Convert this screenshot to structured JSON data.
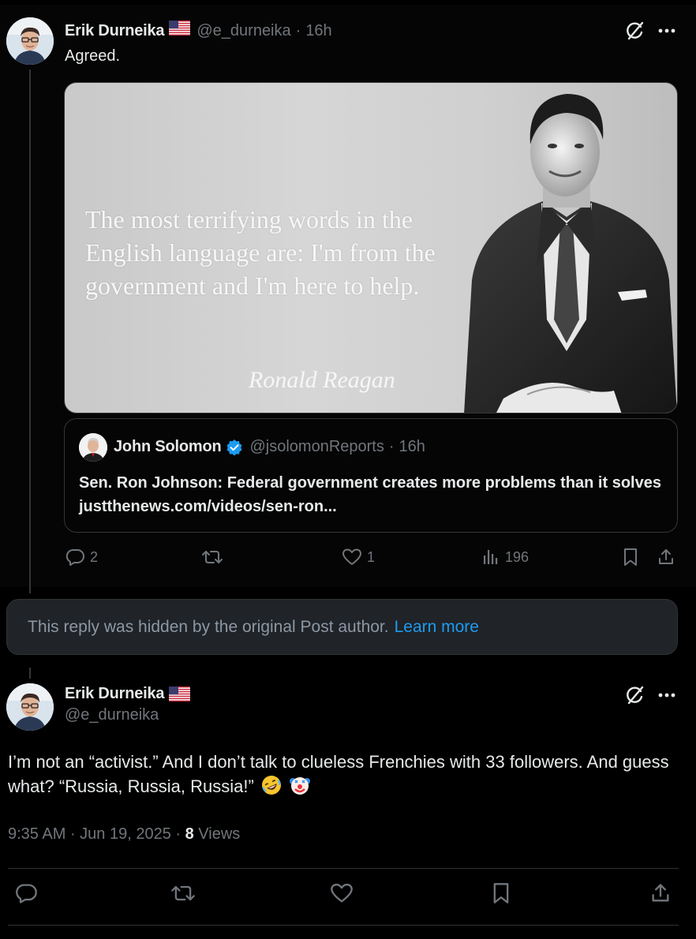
{
  "post1": {
    "author_name": "Erik Durneika",
    "handle": "@e_durneika",
    "time": "16h",
    "text": "Agreed.",
    "image": {
      "quote": "The most terrifying words in the English language are: I'm from the government and I'm here to help.",
      "author": "Ronald Reagan"
    },
    "quoted": {
      "author_name": "John Solomon",
      "handle": "@jsolomonReports",
      "time": "16h",
      "text": "Sen. Ron Johnson: Federal government creates more problems than it solves justthenews.com/videos/sen-ron..."
    },
    "actions": {
      "replies": "2",
      "reposts": "",
      "likes": "1",
      "views": "196"
    }
  },
  "hidden_notice": {
    "text": "This reply was hidden by the original Post author.",
    "link": "Learn more"
  },
  "post2": {
    "author_name": "Erik Durneika",
    "handle": "@e_durneika",
    "text": "I’m not an “activist.” And I don’t talk to clueless Frenchies with 33 followers. And guess what? “Russia, Russia, Russia!”",
    "time": "9:35 AM",
    "date": "Jun 19, 2025",
    "views_count": "8",
    "views_label": "Views"
  },
  "colors": {
    "background": "#000000",
    "text": "#e7e9ea",
    "muted": "#71767b",
    "accent": "#1d9bf0",
    "border": "#2f3336"
  },
  "icons": [
    "grok-icon",
    "more-icon",
    "reply-icon",
    "repost-icon",
    "like-icon",
    "views-icon",
    "bookmark-icon",
    "share-icon",
    "verified-icon",
    "us-flag-icon"
  ]
}
